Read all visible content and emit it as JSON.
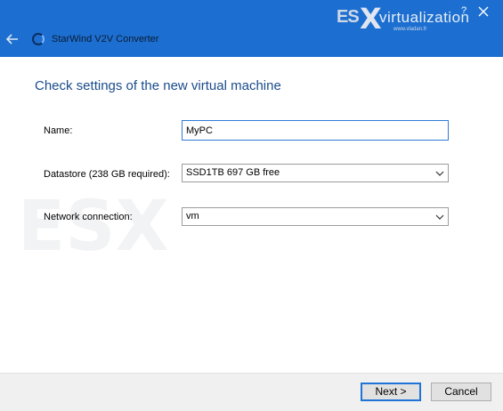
{
  "titlebar": {
    "app_title": "StarWind V2V Converter",
    "help_label": "?",
    "color": "#1c6fd0"
  },
  "watermark": {
    "brand_es": "ES",
    "brand_x": "X",
    "brand_name": "virtualization",
    "url": "www.vladan.fr"
  },
  "main": {
    "heading": "Check settings of the new virtual machine",
    "name_label": "Name:",
    "name_value": "MyPC",
    "datastore_label": "Datastore (238 GB required):",
    "datastore_value": "SSD1TB 697 GB free",
    "network_label": "Network connection:",
    "network_value": "vm"
  },
  "footer": {
    "next_label": "Next >",
    "cancel_label": "Cancel"
  }
}
